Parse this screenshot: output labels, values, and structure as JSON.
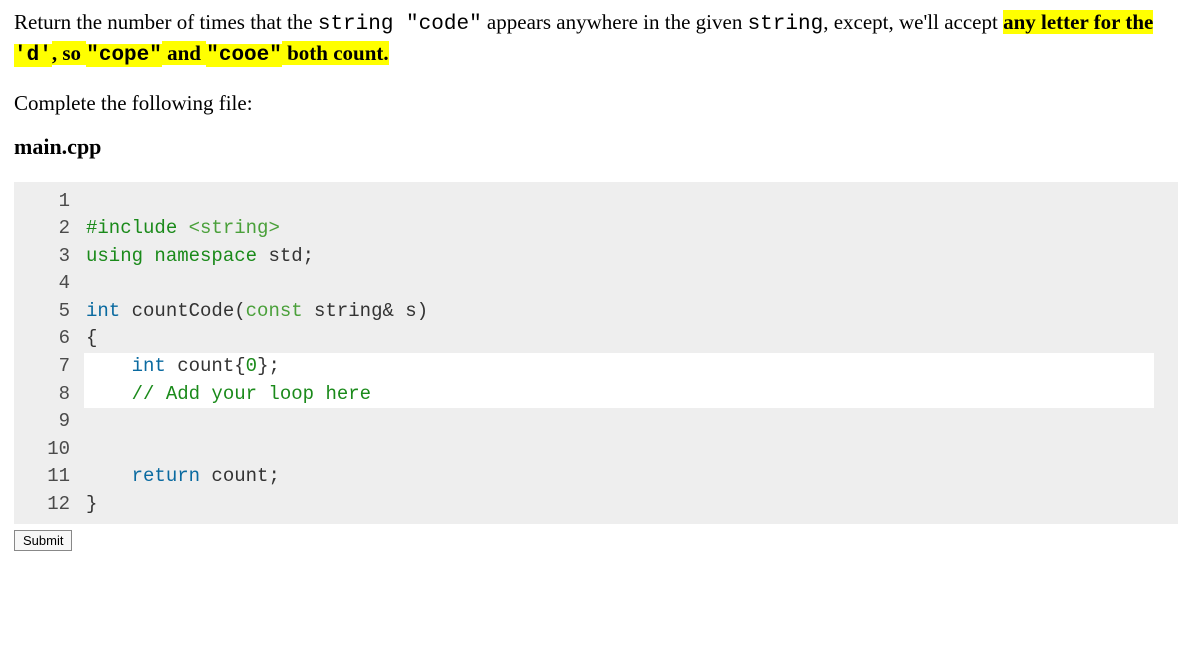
{
  "problem": {
    "pre": "Return the number of times that the ",
    "code1": "string \"code\"",
    "mid1": " appears anywhere in the given ",
    "code2": "string",
    "mid2": ", except, we'll accept ",
    "hl1": "any letter for the ",
    "hl_code": "'d'",
    "hl2": ", so ",
    "hl_code2": "\"cope\"",
    "hl3": " and ",
    "hl_code3": "\"cooe\"",
    "hl4": " both count."
  },
  "complete_text": "Complete the following file:",
  "filename": "main.cpp",
  "code": {
    "lines": [
      {
        "n": "1",
        "kind": "fixed",
        "html": ""
      },
      {
        "n": "2",
        "kind": "fixed",
        "include_kw": "#include",
        "include_path": "<string>"
      },
      {
        "n": "3",
        "kind": "fixed",
        "kw1": "using",
        "kw2": "namespace",
        "id": "std",
        "tail": ";"
      },
      {
        "n": "4",
        "kind": "fixed",
        "html": ""
      },
      {
        "n": "5",
        "kind": "fixed",
        "rettype": "int",
        "fn": " countCode(",
        "const_kw": "const",
        "stype": " string",
        "rest": "& s)"
      },
      {
        "n": "6",
        "kind": "fixed",
        "text": "{"
      },
      {
        "n": "7",
        "kind": "edit",
        "indent": "    ",
        "type_kw": "int",
        "rest1": " count{",
        "num": "0",
        "rest2": "};"
      },
      {
        "n": "8",
        "kind": "edit",
        "indent": "    ",
        "comment": "// Add your loop here"
      },
      {
        "n": "9",
        "kind": "edit",
        "text": ""
      },
      {
        "n": "10",
        "kind": "fixed",
        "text": ""
      },
      {
        "n": "11",
        "kind": "fixed",
        "indent": "    ",
        "kw": "return",
        "rest": " count;"
      },
      {
        "n": "12",
        "kind": "fixed",
        "text": "}"
      }
    ]
  },
  "submit_label": "Submit"
}
